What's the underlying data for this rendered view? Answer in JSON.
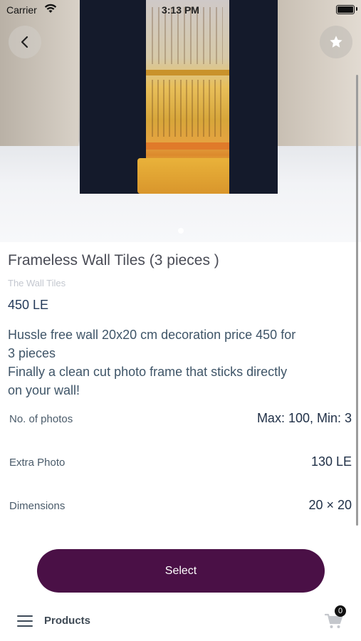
{
  "status_bar": {
    "carrier": "Carrier",
    "time": "3:13 PM"
  },
  "product": {
    "title": "Frameless Wall Tiles (3 pieces )",
    "brand": "The Wall Tiles",
    "price": "450 LE",
    "description_lines": [
      "Hussle free wall 20x20 cm decoration  price 450 for",
      "3 pieces",
      "Finally a clean cut photo frame that sticks directly",
      "on your wall!"
    ],
    "specs": [
      {
        "label": "No. of photos",
        "value": "Max: 100, Min: 3"
      },
      {
        "label": "Extra Photo",
        "value": "130 LE"
      },
      {
        "label": "Dimensions",
        "value": "20 × 20"
      }
    ]
  },
  "actions": {
    "select_label": "Select"
  },
  "bottom_bar": {
    "products_label": "Products",
    "cart_count": "0"
  },
  "icons": {
    "back": "chevron-left-icon",
    "favorite": "star-icon",
    "menu": "hamburger-icon",
    "cart": "cart-icon"
  },
  "colors": {
    "primary": "#4a1046",
    "price": "#243a5a",
    "text": "#3f5568"
  }
}
